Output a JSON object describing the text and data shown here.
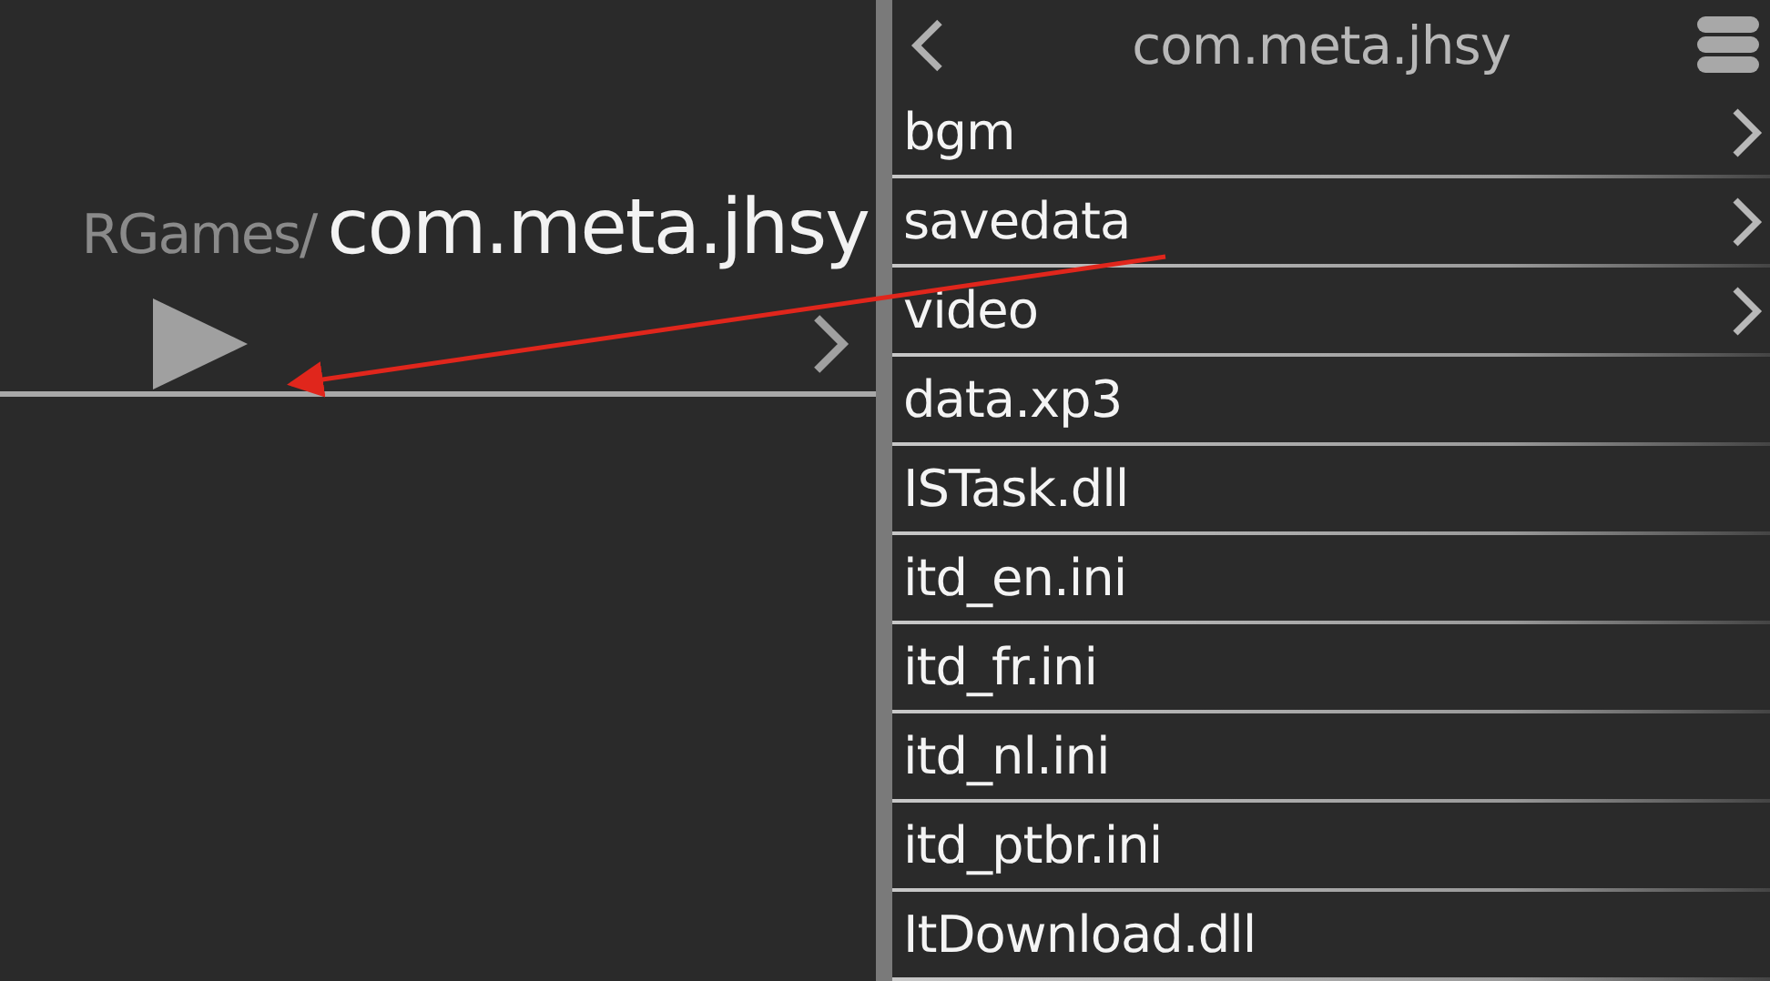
{
  "path_bar": {
    "parent": "RGames/",
    "current": "com.meta.jhsy"
  },
  "browser": {
    "title": "com.meta.jhsy",
    "items": [
      {
        "name": "bgm",
        "kind": "folder"
      },
      {
        "name": "savedata",
        "kind": "folder"
      },
      {
        "name": "video",
        "kind": "folder"
      },
      {
        "name": "data.xp3",
        "kind": "file"
      },
      {
        "name": "ISTask.dll",
        "kind": "file"
      },
      {
        "name": "itd_en.ini",
        "kind": "file"
      },
      {
        "name": "itd_fr.ini",
        "kind": "file"
      },
      {
        "name": "itd_nl.ini",
        "kind": "file"
      },
      {
        "name": "itd_ptbr.ini",
        "kind": "file"
      },
      {
        "name": "ItDownload.dll",
        "kind": "file"
      }
    ]
  }
}
